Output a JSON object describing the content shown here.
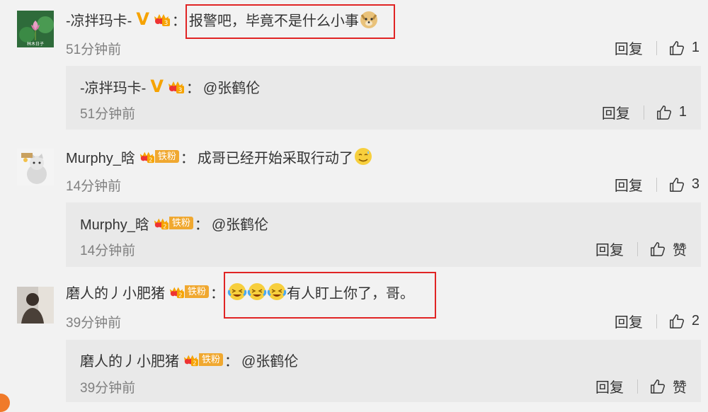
{
  "comments": [
    {
      "name": "-凉拌玛卡-",
      "text": "报警吧，毕竟不是什么小事",
      "time": "51分钟前",
      "reply_label": "回复",
      "likes": "1",
      "reply": {
        "name": "-凉拌玛卡-",
        "text": "@张鹤伦",
        "time": "51分钟前",
        "reply_label": "回复",
        "likes": "1"
      }
    },
    {
      "name": "Murphy_晗",
      "fan_label": "铁粉",
      "text": "成哥已经开始采取行动了",
      "time": "14分钟前",
      "reply_label": "回复",
      "likes": "3",
      "reply": {
        "name": "Murphy_晗",
        "fan_label": "铁粉",
        "text": "@张鹤伦",
        "time": "14分钟前",
        "reply_label": "回复",
        "likes": "赞"
      }
    },
    {
      "name": "磨人的丿小肥猪",
      "fan_label": "铁粉",
      "text": "有人盯上你了，哥。",
      "time": "39分钟前",
      "reply_label": "回复",
      "likes": "2",
      "reply": {
        "name": "磨人的丿小肥猪",
        "fan_label": "铁粉",
        "text": "@张鹤伦",
        "time": "39分钟前",
        "reply_label": "回复",
        "likes": "赞"
      }
    }
  ],
  "colon": "：",
  "avatar_caption": "林木日子",
  "colors": {
    "highlight": "#e02424",
    "vip": "#f6a300",
    "fan_badge": "#f0a830"
  }
}
